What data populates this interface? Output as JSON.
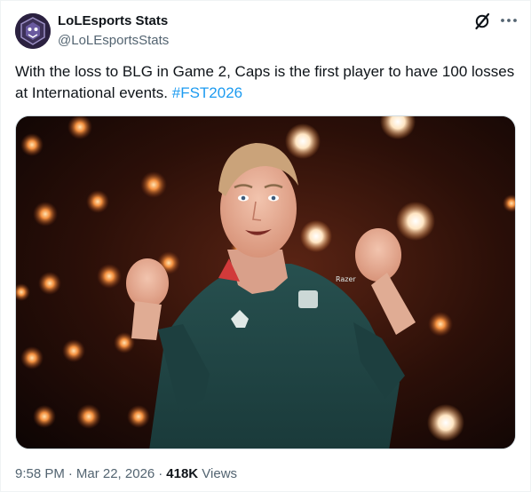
{
  "author": {
    "name": "LoLEsports Stats",
    "handle": "@LoLEsportsStats",
    "avatar_icon": "lolesports-stats-logo-icon"
  },
  "header_actions": {
    "grok_icon": "grok-icon",
    "more_icon": "more-options-icon"
  },
  "tweet": {
    "text": "With the loss to BLG in Game 2, Caps is the first player to have 100 losses at International events. ",
    "hashtag": "#FST2026"
  },
  "media": {
    "alt": "Caps in a dark teal G2 Esports jersey, both fists raised, in front of a wall of glowing stage lights"
  },
  "meta": {
    "time": "9:58 PM",
    "date": "Mar 22, 2026",
    "views_count": "418K",
    "views_label": "Views"
  },
  "colors": {
    "accent": "#1d9bf0",
    "muted_text": "#536471",
    "main_text": "#0f1419"
  }
}
